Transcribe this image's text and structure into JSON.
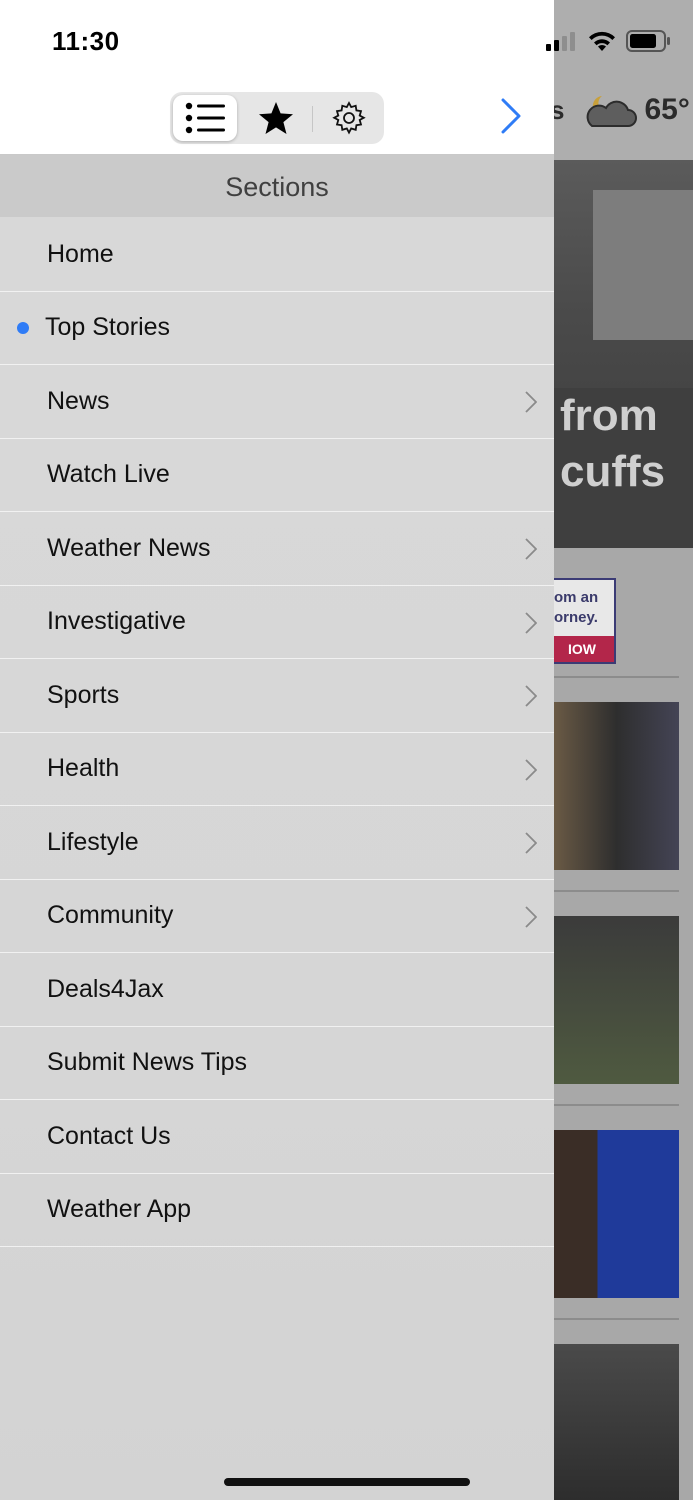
{
  "status_bar": {
    "time": "11:30"
  },
  "toolbar": {
    "segments": [
      {
        "name": "sections",
        "icon": "list-icon",
        "selected": true
      },
      {
        "name": "favorites",
        "icon": "star-icon",
        "selected": false
      },
      {
        "name": "settings",
        "icon": "gear-icon",
        "selected": false
      }
    ]
  },
  "background_app": {
    "weather_temp": "65°",
    "weather_prefix": "s",
    "hero_headline_fragment_1": "from",
    "hero_headline_fragment_2": "cuffs",
    "ad_line_1": "om an",
    "ad_line_2": "orney.",
    "ad_button": "IOW"
  },
  "drawer": {
    "title": "Sections",
    "items": [
      {
        "label": "Home",
        "has_children": false,
        "current": false
      },
      {
        "label": "Top Stories",
        "has_children": false,
        "current": true
      },
      {
        "label": "News",
        "has_children": true,
        "current": false
      },
      {
        "label": "Watch Live",
        "has_children": false,
        "current": false
      },
      {
        "label": "Weather News",
        "has_children": true,
        "current": false
      },
      {
        "label": "Investigative",
        "has_children": true,
        "current": false
      },
      {
        "label": "Sports",
        "has_children": true,
        "current": false
      },
      {
        "label": "Health",
        "has_children": true,
        "current": false
      },
      {
        "label": "Lifestyle",
        "has_children": true,
        "current": false
      },
      {
        "label": "Community",
        "has_children": true,
        "current": false
      },
      {
        "label": "Deals4Jax",
        "has_children": false,
        "current": false
      },
      {
        "label": "Submit News Tips",
        "has_children": false,
        "current": false
      },
      {
        "label": "Contact Us",
        "has_children": false,
        "current": false
      },
      {
        "label": "Weather App",
        "has_children": false,
        "current": false
      }
    ]
  },
  "colors": {
    "accent": "#2f7cf6",
    "drawer_bg": "#d9d9d9",
    "header_bg": "#cacaca",
    "separator": "#f1f1f1"
  }
}
